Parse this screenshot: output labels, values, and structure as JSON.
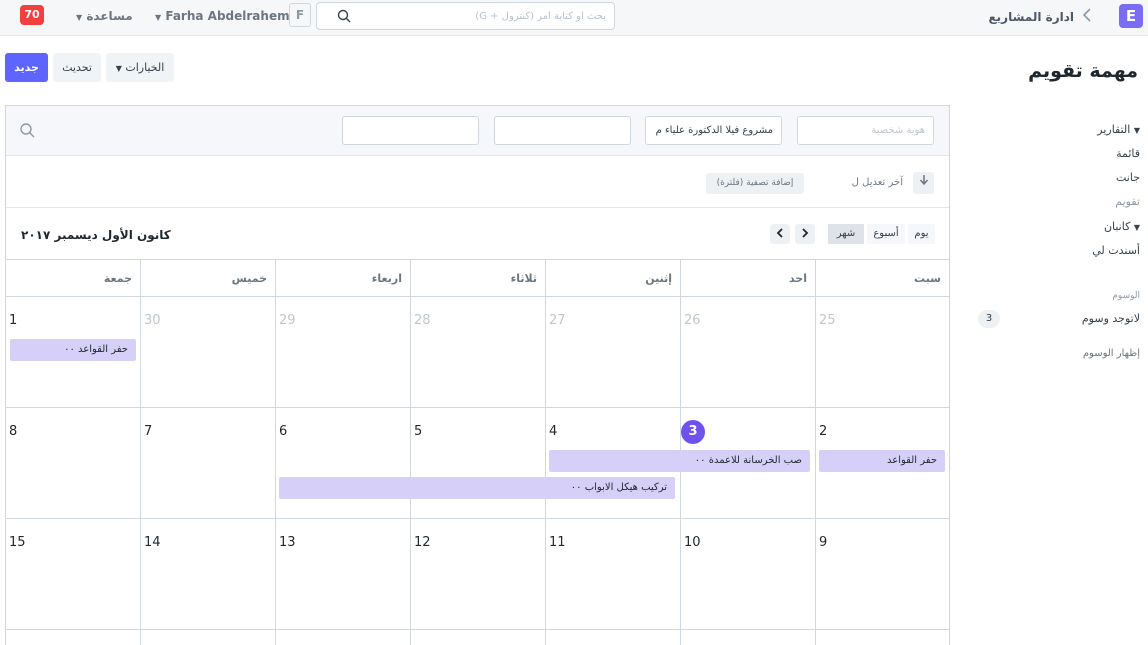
{
  "navbar": {
    "logo_letter": "E",
    "breadcrumb_module": "ادارة المشاريع",
    "search_placeholder": "بحث أو كتابة أمر (كنترول + G)",
    "avatar_letter": "F",
    "user_name": "Farha Abdelrahem",
    "help_label": "مساعدة",
    "notification_count": "70"
  },
  "page": {
    "title": "مهمة تقويم",
    "new_label": "جديد",
    "refresh_label": "تحديث",
    "options_label": "الخيارات"
  },
  "sidebar": {
    "reports": "التقارير",
    "list": "قائمة",
    "gantt": "جانت",
    "calendar": "تقويم",
    "kanban": "كانبان",
    "assigned_to_me": "أسندت لي",
    "tags_heading": "الوسوم",
    "no_tags": "لاتوجد وسوم",
    "no_tags_count": "3",
    "show_tags": "إظهار الوسوم"
  },
  "filters": {
    "id_placeholder": "هوية شخصية",
    "project_value": "مشروع فيلا الدكتورة علياء م",
    "field3": "",
    "field4": ""
  },
  "sort": {
    "label": "آخر تعديل ل",
    "add_filter": "إضافة تصفية (فلترة)"
  },
  "calendar": {
    "title": "كانون الأول ديسمبر ٢٠١٧",
    "views": {
      "day": "يوم",
      "week": "أسبوع",
      "month": "شهر"
    },
    "dow": [
      "سبت",
      "احد",
      "إثنين",
      "ثلاثاء",
      "اربعاء",
      "خميس",
      "جمعة"
    ],
    "weeks": [
      [
        "25",
        "26",
        "27",
        "28",
        "29",
        "30",
        "1"
      ],
      [
        "2",
        "3",
        "4",
        "5",
        "6",
        "7",
        "8"
      ],
      [
        "9",
        "10",
        "11",
        "12",
        "13",
        "14",
        "15"
      ]
    ],
    "events": [
      {
        "title": "حفر القواعد ٠٠"
      },
      {
        "title": "حفر القواعد"
      },
      {
        "title": "صب الخرسانة للاعمدة ٠٠"
      },
      {
        "title": "تركيب هيكل الابواب ٠٠"
      }
    ],
    "accent_color": "#6f52ed",
    "event_color": "#d6d0f9"
  }
}
